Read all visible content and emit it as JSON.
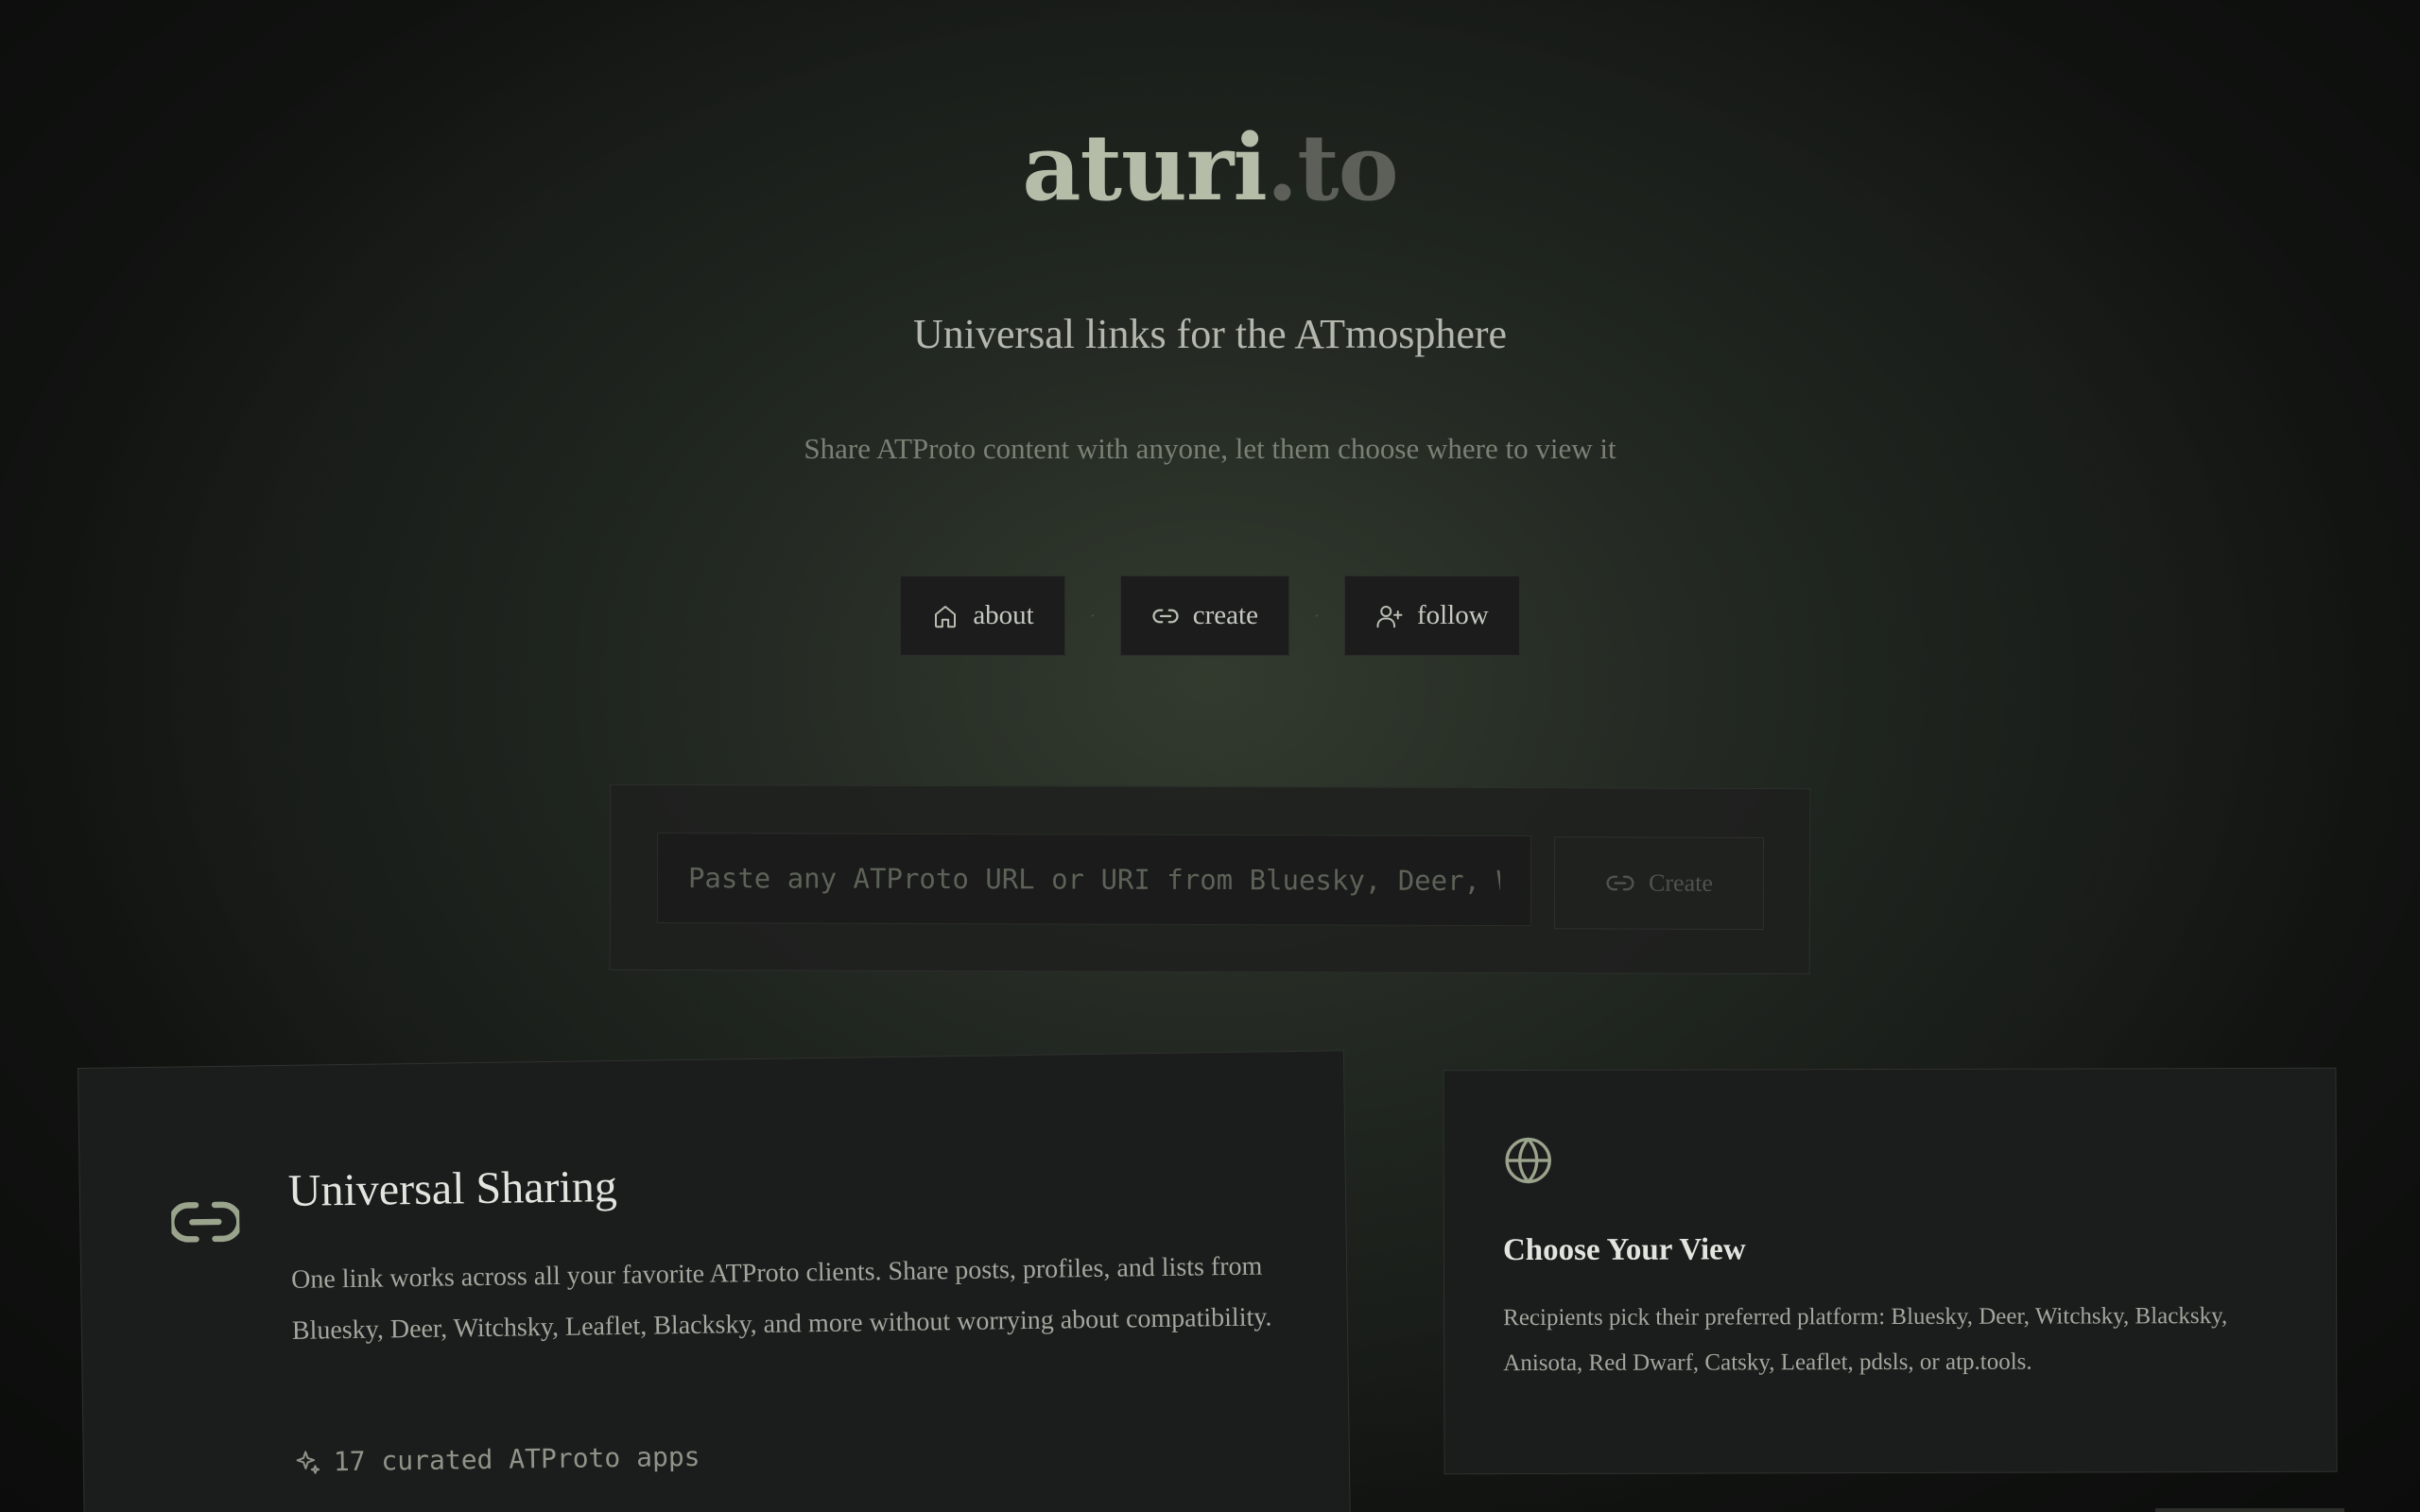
{
  "brand": {
    "main": "aturi",
    "suffix": ".to"
  },
  "hero": {
    "tagline": "Universal links for the ATmosphere",
    "subtitle": "Share ATProto content with anyone, let them choose where to view it"
  },
  "nav": {
    "items": [
      {
        "label": "about",
        "icon": "home-icon"
      },
      {
        "label": "create",
        "icon": "link-icon"
      },
      {
        "label": "follow",
        "icon": "user-plus-icon"
      }
    ],
    "separator": "·"
  },
  "create": {
    "placeholder": "Paste any ATProto URL or URI from Bluesky, Deer, Witchsky, Leaflet, Blacksky...",
    "value": "",
    "button_label": "Create",
    "button_icon": "link-icon"
  },
  "features": {
    "sharing": {
      "icon": "link-icon",
      "title": "Universal Sharing",
      "description": "One link works across all your favorite ATProto clients. Share posts, profiles, and lists from Bluesky, Deer, Witchsky, Leaflet, Blacksky, and more without worrying about compatibility.",
      "count_icon": "sparkles-icon",
      "count_text": "17 curated ATProto apps"
    },
    "view": {
      "icon": "globe-icon",
      "title": "Choose Your View",
      "description": "Recipients pick their preferred platform: Bluesky, Deer, Witchsky, Blacksky, Anisota, Red Dwarf, Catsky, Leaflet, pdsls, or atp.tools."
    }
  },
  "colors": {
    "accent": "#9aa48c",
    "background": "#1e221e",
    "card": "#1b1c1c",
    "text": "#c8ccc4"
  }
}
